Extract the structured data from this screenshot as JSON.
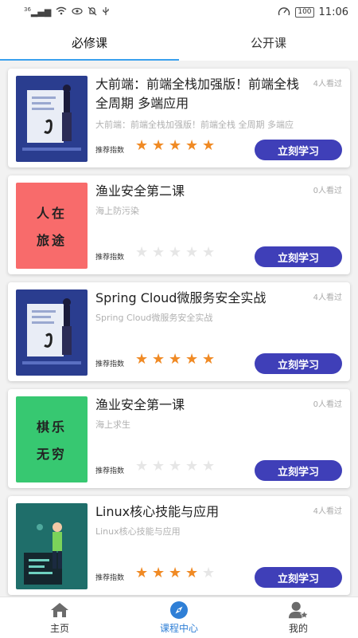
{
  "status_bar": {
    "left_icons": [
      "signal-icon",
      "wifi-icon",
      "eye-icon",
      "mute-icon",
      "usb-icon"
    ],
    "signal_text": "36",
    "battery": "100",
    "time": "11:06"
  },
  "tabs": [
    {
      "label": "必修课",
      "active": true
    },
    {
      "label": "公开课",
      "active": false
    }
  ],
  "courses": [
    {
      "title": "大前端：前端全栈加强版！前端全栈 全周期 多端应用",
      "subtitle": "大前端：前端全栈加强版！前端全栈 全周期 多端应",
      "views": "4人看过",
      "rating_label": "推荐指数",
      "rating": 5,
      "button": "立刻学习",
      "thumb": {
        "style": "illustration-blue",
        "lines": []
      }
    },
    {
      "title": "渔业安全第二课",
      "subtitle": "海上防污染",
      "views": "0人看过",
      "rating_label": "推荐指数",
      "rating": 0,
      "button": "立刻学习",
      "thumb": {
        "style": "solid",
        "color": "#f86b6b",
        "lines": [
          "人在",
          "旅途"
        ]
      }
    },
    {
      "title": "Spring Cloud微服务安全实战",
      "subtitle": "Spring Cloud微服务安全实战",
      "views": "4人看过",
      "rating_label": "推荐指数",
      "rating": 5,
      "button": "立刻学习",
      "thumb": {
        "style": "illustration-blue",
        "lines": []
      }
    },
    {
      "title": "渔业安全第一课",
      "subtitle": "海上求生",
      "views": "0人看过",
      "rating_label": "推荐指数",
      "rating": 0,
      "button": "立刻学习",
      "thumb": {
        "style": "solid",
        "color": "#37c871",
        "lines": [
          "棋乐",
          "无穷"
        ]
      }
    },
    {
      "title": "Linux核心技能与应用",
      "subtitle": "Linux核心技能与应用",
      "views": "4人看过",
      "rating_label": "推荐指数",
      "rating": 4,
      "button": "立刻学习",
      "thumb": {
        "style": "illustration-teal",
        "lines": []
      }
    }
  ],
  "bottom_nav": [
    {
      "label": "主页",
      "icon": "home-icon",
      "active": false
    },
    {
      "label": "课程中心",
      "icon": "compass-icon",
      "active": true
    },
    {
      "label": "我的",
      "icon": "user-icon",
      "active": false
    }
  ],
  "colors": {
    "accent": "#3f3fb8",
    "tab_indicator": "#3aa0ee",
    "nav_active": "#2f7fd6",
    "star_on": "#f08a24",
    "star_off": "#e6e6e6"
  }
}
